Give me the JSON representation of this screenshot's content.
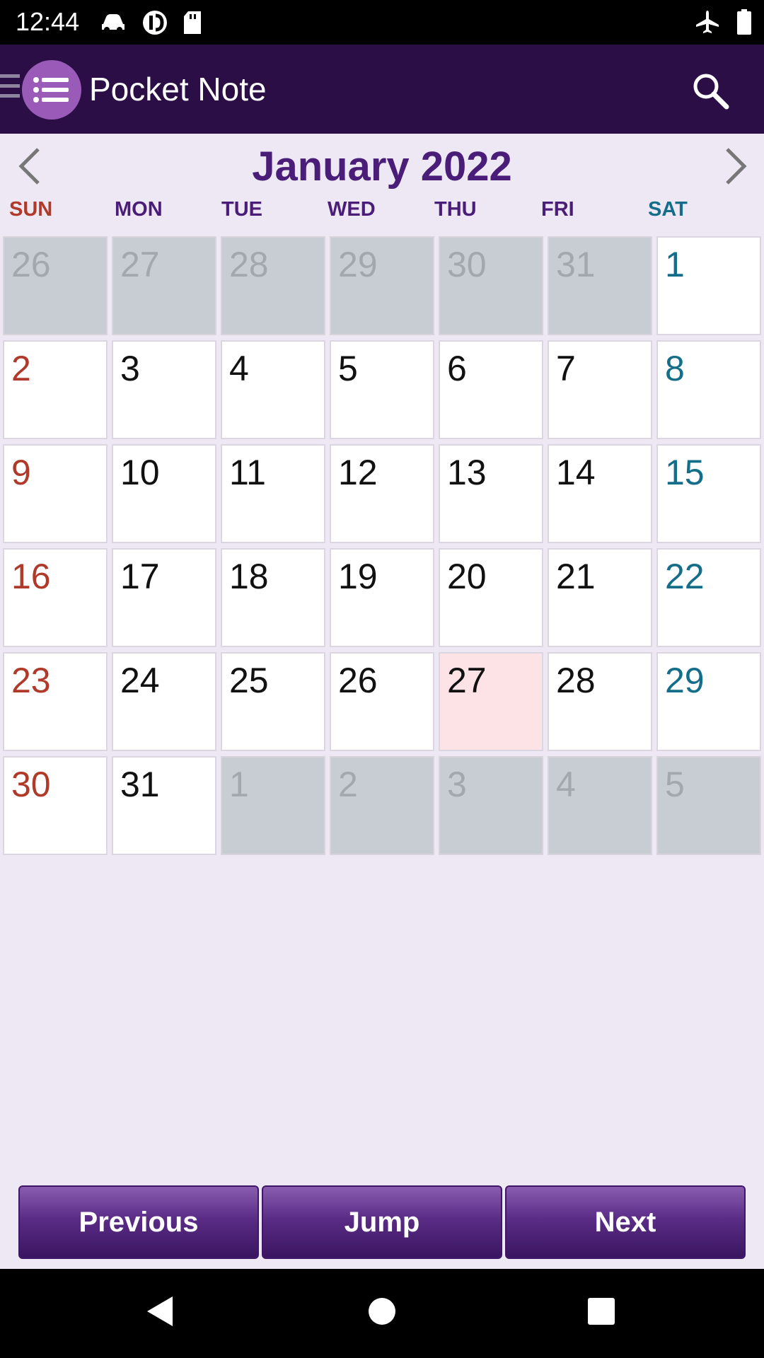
{
  "status_bar": {
    "time": "12:44",
    "left_icons": [
      "car-icon",
      "refresh-icon",
      "sd-card-icon"
    ],
    "right_icons": [
      "airplane-icon",
      "battery-icon"
    ]
  },
  "app_bar": {
    "title": "Pocket Note",
    "menu_icon": "menu-icon",
    "logo_icon": "list-icon",
    "search_icon": "search-icon"
  },
  "calendar": {
    "month_title": "January 2022",
    "weekdays": [
      "SUN",
      "MON",
      "TUE",
      "WED",
      "THU",
      "FRI",
      "SAT"
    ],
    "weeks": [
      [
        "26",
        "27",
        "28",
        "29",
        "30",
        "31",
        "1"
      ],
      [
        "2",
        "3",
        "4",
        "5",
        "6",
        "7",
        "8"
      ],
      [
        "9",
        "10",
        "11",
        "12",
        "13",
        "14",
        "15"
      ],
      [
        "16",
        "17",
        "18",
        "19",
        "20",
        "21",
        "22"
      ],
      [
        "23",
        "24",
        "25",
        "26",
        "27",
        "28",
        "29"
      ],
      [
        "30",
        "31",
        "1",
        "2",
        "3",
        "4",
        "5"
      ]
    ],
    "today": "27"
  },
  "buttons": {
    "previous": "Previous",
    "jump": "Jump",
    "next": "Next"
  },
  "colors": {
    "app_bar": "#2a0e45",
    "title": "#4a1e78",
    "sunday": "#b03a2a",
    "saturday": "#146e8a",
    "weekday_header": "#4a1e78",
    "out_of_month_bg": "#c8cdd4",
    "today_bg": "#fde3e6"
  }
}
